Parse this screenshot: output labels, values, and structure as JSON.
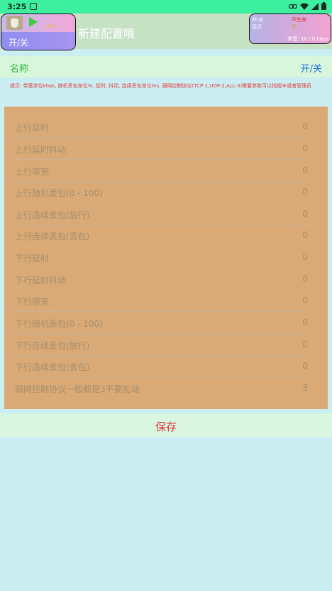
{
  "status_bar": {
    "time": "3:25"
  },
  "header": {
    "title": "新建配置哦"
  },
  "float_left": {
    "toggle_label": "开/关"
  },
  "float_right": {
    "row1_label": "开/关",
    "row1_value": "不生效",
    "row2_label": "延迟",
    "row2_value": "无",
    "bandwidth": "带宽: 10 / 0 kbps"
  },
  "name_row": {
    "label": "名称",
    "toggle": "开/关"
  },
  "hint": "提示: 带宽单位kbps, 随机丢包单位%, 延时, 抖动, 连续丢包单位ms, 弱网控制协议(TCP:1,UDP:2,ALL:3)需要参数可以找程丰或者管理员",
  "settings": [
    {
      "label": "上行延时",
      "value": "0"
    },
    {
      "label": "上行延时抖动",
      "value": "0"
    },
    {
      "label": "上行带宽",
      "value": "0"
    },
    {
      "label": "上行随机丢包(0 - 100)",
      "value": "0"
    },
    {
      "label": "上行连续丢包(放行)",
      "value": "0"
    },
    {
      "label": "上行连续丢包(丢包)",
      "value": "0"
    },
    {
      "label": "下行延时",
      "value": "0"
    },
    {
      "label": "下行延时抖动",
      "value": "0"
    },
    {
      "label": "下行带宽",
      "value": "0"
    },
    {
      "label": "下行随机丢包(0 - 100)",
      "value": "0"
    },
    {
      "label": "下行连续丢包(放行)",
      "value": "0"
    },
    {
      "label": "下行连续丢包(丢包)",
      "value": "0"
    },
    {
      "label": "弱网控制协议一般都是3不要乱动",
      "value": "3"
    }
  ],
  "save": {
    "label": "保存"
  },
  "colors": {
    "status_bar_bg": "#3df0a0",
    "panel_bg": "#d9aa76",
    "save_text": "#e03838",
    "name_label": "#2dbb3c",
    "toggle_text": "#1f6fe0"
  }
}
